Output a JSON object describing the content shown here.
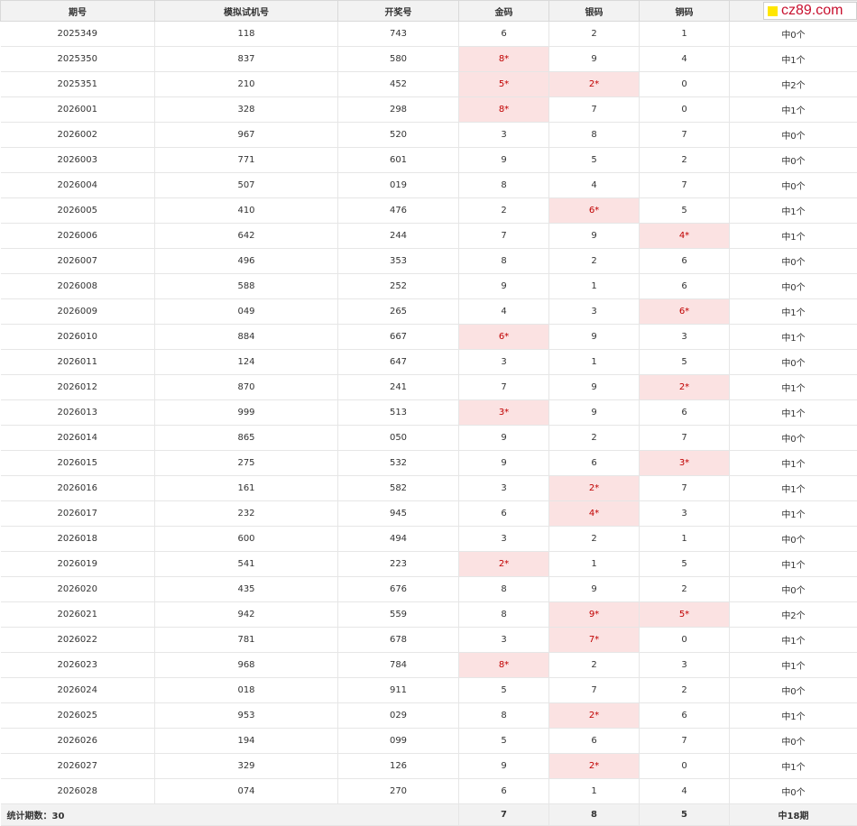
{
  "headers": [
    "期号",
    "模拟试机号",
    "开奖号",
    "金码",
    "银码",
    "铜码",
    ""
  ],
  "rows": [
    {
      "period": "2025349",
      "trial": "118",
      "draw": "743",
      "gold": "6",
      "silver": "2",
      "bronze": "1",
      "result": "中0个",
      "hit": []
    },
    {
      "period": "2025350",
      "trial": "837",
      "draw": "580",
      "gold": "8*",
      "silver": "9",
      "bronze": "4",
      "result": "中1个",
      "hit": [
        "gold"
      ]
    },
    {
      "period": "2025351",
      "trial": "210",
      "draw": "452",
      "gold": "5*",
      "silver": "2*",
      "bronze": "0",
      "result": "中2个",
      "hit": [
        "gold",
        "silver"
      ]
    },
    {
      "period": "2026001",
      "trial": "328",
      "draw": "298",
      "gold": "8*",
      "silver": "7",
      "bronze": "0",
      "result": "中1个",
      "hit": [
        "gold"
      ]
    },
    {
      "period": "2026002",
      "trial": "967",
      "draw": "520",
      "gold": "3",
      "silver": "8",
      "bronze": "7",
      "result": "中0个",
      "hit": []
    },
    {
      "period": "2026003",
      "trial": "771",
      "draw": "601",
      "gold": "9",
      "silver": "5",
      "bronze": "2",
      "result": "中0个",
      "hit": []
    },
    {
      "period": "2026004",
      "trial": "507",
      "draw": "019",
      "gold": "8",
      "silver": "4",
      "bronze": "7",
      "result": "中0个",
      "hit": []
    },
    {
      "period": "2026005",
      "trial": "410",
      "draw": "476",
      "gold": "2",
      "silver": "6*",
      "bronze": "5",
      "result": "中1个",
      "hit": [
        "silver"
      ]
    },
    {
      "period": "2026006",
      "trial": "642",
      "draw": "244",
      "gold": "7",
      "silver": "9",
      "bronze": "4*",
      "result": "中1个",
      "hit": [
        "bronze"
      ]
    },
    {
      "period": "2026007",
      "trial": "496",
      "draw": "353",
      "gold": "8",
      "silver": "2",
      "bronze": "6",
      "result": "中0个",
      "hit": []
    },
    {
      "period": "2026008",
      "trial": "588",
      "draw": "252",
      "gold": "9",
      "silver": "1",
      "bronze": "6",
      "result": "中0个",
      "hit": []
    },
    {
      "period": "2026009",
      "trial": "049",
      "draw": "265",
      "gold": "4",
      "silver": "3",
      "bronze": "6*",
      "result": "中1个",
      "hit": [
        "bronze"
      ]
    },
    {
      "period": "2026010",
      "trial": "884",
      "draw": "667",
      "gold": "6*",
      "silver": "9",
      "bronze": "3",
      "result": "中1个",
      "hit": [
        "gold"
      ]
    },
    {
      "period": "2026011",
      "trial": "124",
      "draw": "647",
      "gold": "3",
      "silver": "1",
      "bronze": "5",
      "result": "中0个",
      "hit": []
    },
    {
      "period": "2026012",
      "trial": "870",
      "draw": "241",
      "gold": "7",
      "silver": "9",
      "bronze": "2*",
      "result": "中1个",
      "hit": [
        "bronze"
      ]
    },
    {
      "period": "2026013",
      "trial": "999",
      "draw": "513",
      "gold": "3*",
      "silver": "9",
      "bronze": "6",
      "result": "中1个",
      "hit": [
        "gold"
      ]
    },
    {
      "period": "2026014",
      "trial": "865",
      "draw": "050",
      "gold": "9",
      "silver": "2",
      "bronze": "7",
      "result": "中0个",
      "hit": []
    },
    {
      "period": "2026015",
      "trial": "275",
      "draw": "532",
      "gold": "9",
      "silver": "6",
      "bronze": "3*",
      "result": "中1个",
      "hit": [
        "bronze"
      ]
    },
    {
      "period": "2026016",
      "trial": "161",
      "draw": "582",
      "gold": "3",
      "silver": "2*",
      "bronze": "7",
      "result": "中1个",
      "hit": [
        "silver"
      ]
    },
    {
      "period": "2026017",
      "trial": "232",
      "draw": "945",
      "gold": "6",
      "silver": "4*",
      "bronze": "3",
      "result": "中1个",
      "hit": [
        "silver"
      ]
    },
    {
      "period": "2026018",
      "trial": "600",
      "draw": "494",
      "gold": "3",
      "silver": "2",
      "bronze": "1",
      "result": "中0个",
      "hit": []
    },
    {
      "period": "2026019",
      "trial": "541",
      "draw": "223",
      "gold": "2*",
      "silver": "1",
      "bronze": "5",
      "result": "中1个",
      "hit": [
        "gold"
      ]
    },
    {
      "period": "2026020",
      "trial": "435",
      "draw": "676",
      "gold": "8",
      "silver": "9",
      "bronze": "2",
      "result": "中0个",
      "hit": []
    },
    {
      "period": "2026021",
      "trial": "942",
      "draw": "559",
      "gold": "8",
      "silver": "9*",
      "bronze": "5*",
      "result": "中2个",
      "hit": [
        "silver",
        "bronze"
      ]
    },
    {
      "period": "2026022",
      "trial": "781",
      "draw": "678",
      "gold": "3",
      "silver": "7*",
      "bronze": "0",
      "result": "中1个",
      "hit": [
        "silver"
      ]
    },
    {
      "period": "2026023",
      "trial": "968",
      "draw": "784",
      "gold": "8*",
      "silver": "2",
      "bronze": "3",
      "result": "中1个",
      "hit": [
        "gold"
      ]
    },
    {
      "period": "2026024",
      "trial": "018",
      "draw": "911",
      "gold": "5",
      "silver": "7",
      "bronze": "2",
      "result": "中0个",
      "hit": []
    },
    {
      "period": "2026025",
      "trial": "953",
      "draw": "029",
      "gold": "8",
      "silver": "2*",
      "bronze": "6",
      "result": "中1个",
      "hit": [
        "silver"
      ]
    },
    {
      "period": "2026026",
      "trial": "194",
      "draw": "099",
      "gold": "5",
      "silver": "6",
      "bronze": "7",
      "result": "中0个",
      "hit": []
    },
    {
      "period": "2026027",
      "trial": "329",
      "draw": "126",
      "gold": "9",
      "silver": "2*",
      "bronze": "0",
      "result": "中1个",
      "hit": [
        "silver"
      ]
    },
    {
      "period": "2026028",
      "trial": "074",
      "draw": "270",
      "gold": "6",
      "silver": "1",
      "bronze": "4",
      "result": "中0个",
      "hit": []
    }
  ],
  "summary": {
    "label": "统计期数：30",
    "gold": "7",
    "silver": "8",
    "bronze": "5",
    "result": "中18期"
  },
  "logo": {
    "text": "cz89.com"
  },
  "colors": {
    "hit_bg": "#fbe2e2",
    "hit_text": "#c00000",
    "header_bg": "#f2f2f2",
    "logo_square": "#ffe600",
    "logo_text": "#c8102e"
  }
}
